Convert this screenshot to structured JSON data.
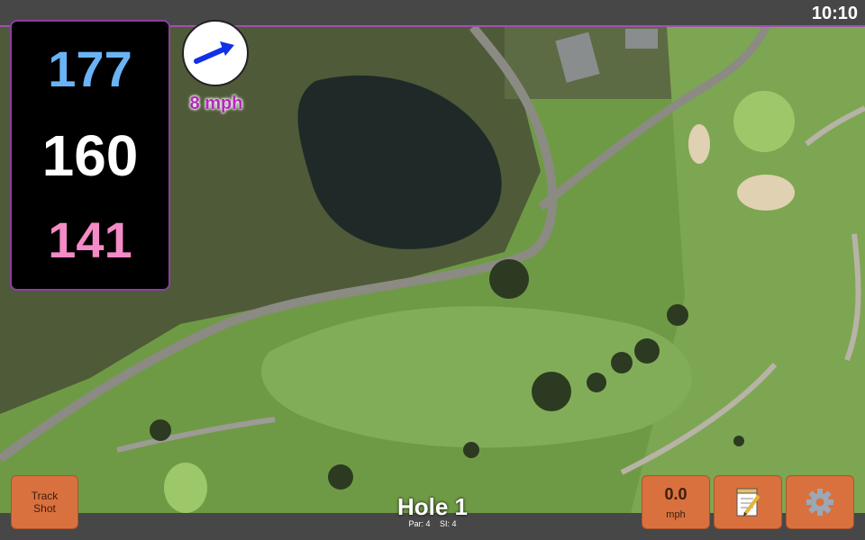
{
  "status_bar": {
    "time": "10:10"
  },
  "distances": {
    "back": "177",
    "middle": "160",
    "front": "141",
    "colors": {
      "back": "#6ab3f5",
      "middle": "#ffffff",
      "front": "#f48ac6"
    }
  },
  "wind": {
    "speed_label": "8 mph",
    "direction_icon": "wind-arrow-icon",
    "color": "#b12ab8"
  },
  "buttons": {
    "track_shot": "Track Shot",
    "speed_value": "0.0",
    "speed_unit": "mph",
    "notes_icon": "notepad-icon",
    "settings_icon": "gear-icon",
    "color": "#d9713f"
  },
  "hole": {
    "title": "Hole 1",
    "par_label": "Par: 4",
    "si_label": "SI: 4"
  }
}
